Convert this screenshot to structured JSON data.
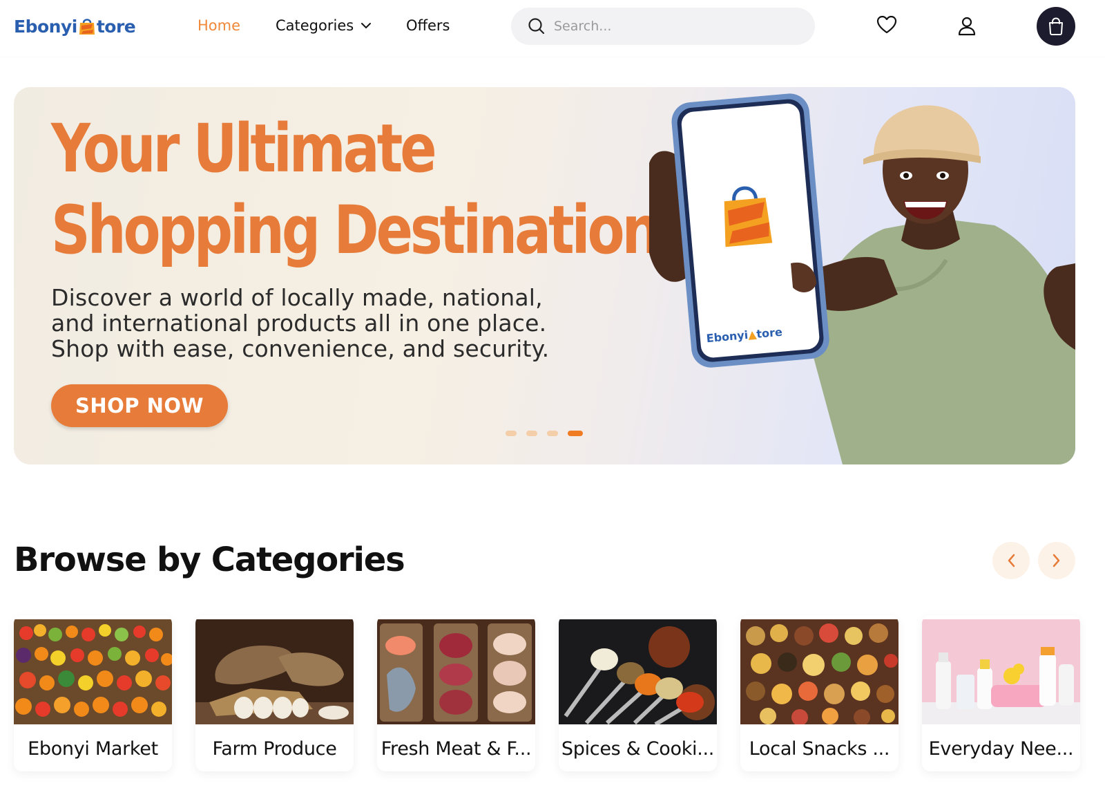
{
  "header": {
    "logo": {
      "part1": "Ebonyi",
      "part2": "tore"
    },
    "nav": {
      "home": "Home",
      "categories": "Categories",
      "offers": "Offers"
    },
    "search": {
      "placeholder": "Search..."
    },
    "colors": {
      "accent": "#f0883a",
      "brand_blue": "#2a5fb0",
      "cart_bg": "#1c1c2e"
    }
  },
  "hero": {
    "title_line1": "Your Ultimate",
    "title_line2": "Shopping Destination",
    "description": "Discover a world of locally made, national, and international products all in one place. Shop with ease, convenience, and security.",
    "cta": "SHOP NOW",
    "slides": {
      "count": 4,
      "active": 4
    },
    "phone_logo": {
      "part1": "Ebonyi",
      "part2": "tore"
    }
  },
  "browse": {
    "title": "Browse by Categories",
    "categories": [
      {
        "label": "Ebonyi Market",
        "image": "fruit-market"
      },
      {
        "label": "Farm Produce",
        "image": "yams"
      },
      {
        "label": "Fresh Meat & F...",
        "image": "meat-fish"
      },
      {
        "label": "Spices & Cooki...",
        "image": "spices"
      },
      {
        "label": "Local Snacks ...",
        "image": "snacks"
      },
      {
        "label": "Everyday Nee...",
        "image": "baby-toiletries"
      }
    ]
  }
}
